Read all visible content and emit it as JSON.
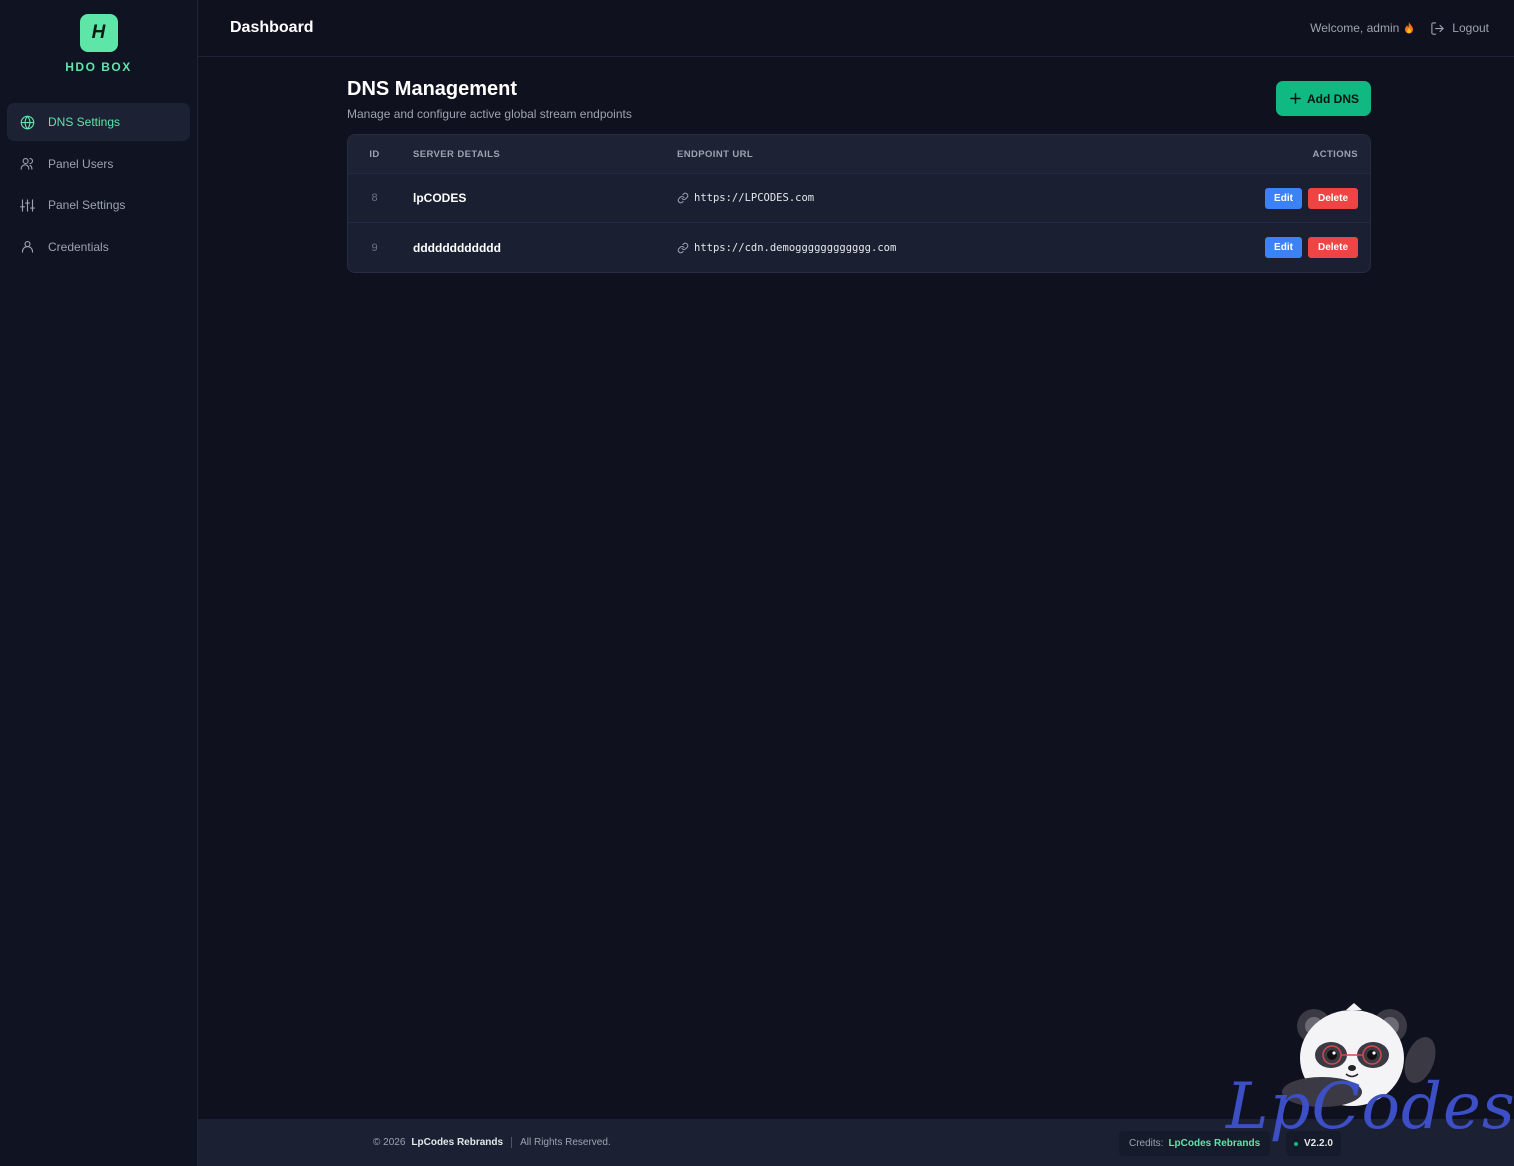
{
  "brand": {
    "logo_letter": "H",
    "name": "HDO BOX"
  },
  "sidebar": {
    "items": [
      {
        "label": "DNS Settings",
        "icon": "globe-icon",
        "active": true
      },
      {
        "label": "Panel Users",
        "icon": "users-icon",
        "active": false
      },
      {
        "label": "Panel Settings",
        "icon": "sliders-icon",
        "active": false
      },
      {
        "label": "Credentials",
        "icon": "user-icon",
        "active": false
      }
    ]
  },
  "topbar": {
    "title": "Dashboard",
    "welcome": "Welcome, admin",
    "logout": "Logout"
  },
  "page": {
    "title": "DNS Management",
    "subtitle": "Manage and configure active global stream endpoints",
    "add_button": "Add DNS"
  },
  "table": {
    "headers": [
      "ID",
      "SERVER DETAILS",
      "ENDPOINT URL",
      "ACTIONS"
    ],
    "rows": [
      {
        "id": "8",
        "server": "lpCODES",
        "url": "https://LPCODES.com"
      },
      {
        "id": "9",
        "server": "dddddddddddd",
        "url": "https://cdn.demogggggggggggg.com"
      }
    ],
    "edit_label": "Edit",
    "delete_label": "Delete"
  },
  "footer": {
    "copyright": "© 2026",
    "brand": "LpCodes Rebrands",
    "rights": "All Rights Reserved.",
    "credits_label": "Credits:",
    "credits_name": "LpCodes Rebrands",
    "version": "V2.2.0"
  },
  "watermark": {
    "text": "LpCodes"
  },
  "colors": {
    "accent": "#5ee6a8",
    "primary_button": "#10b981",
    "edit": "#3b82f6",
    "delete": "#ef4444",
    "background": "#0f111e"
  }
}
